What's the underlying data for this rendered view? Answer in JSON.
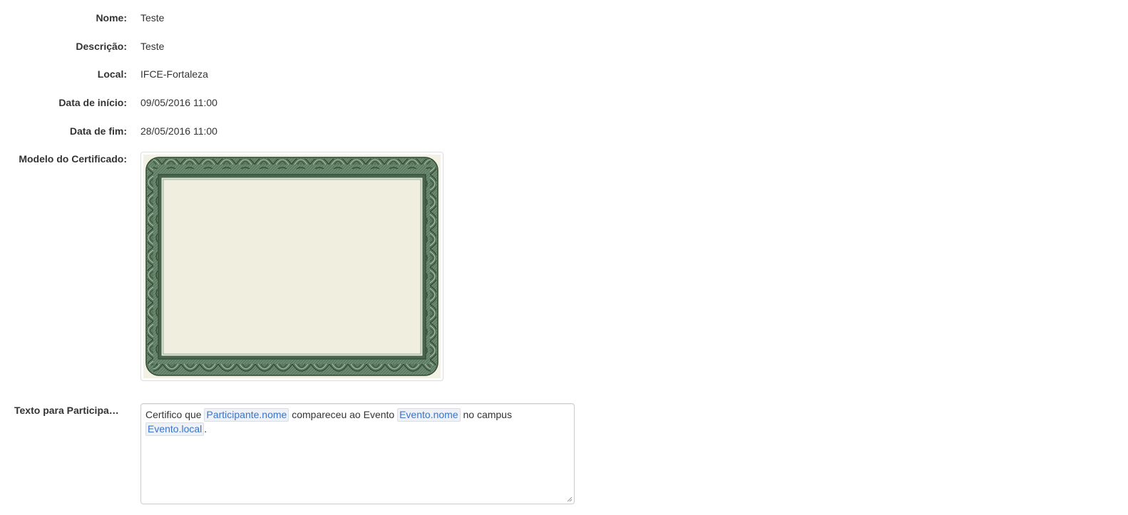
{
  "fields": [
    {
      "label": "Nome:",
      "value": "Teste"
    },
    {
      "label": "Descrição:",
      "value": "Teste"
    },
    {
      "label": "Local:",
      "value": "IFCE-Fortaleza"
    },
    {
      "label": "Data de início:",
      "value": "09/05/2016 11:00"
    },
    {
      "label": "Data de fim:",
      "value": "28/05/2016 11:00"
    }
  ],
  "certificate": {
    "label": "Modelo do Certificado:",
    "border_color": "#4f6b52",
    "paper_color": "#f0eedf"
  },
  "participant_text": {
    "label": "Texto para Participante:",
    "parts": {
      "t1": "Certifico que ",
      "v1": "Participante.nome",
      "t2": " compareceu ao Evento ",
      "v2": "Evento.nome",
      "t3": " no campus",
      "v3": "Evento.local",
      "t4": "."
    }
  }
}
